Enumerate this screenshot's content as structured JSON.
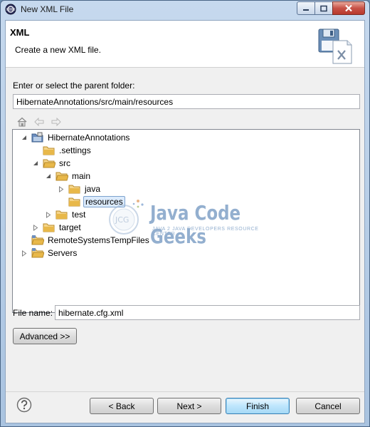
{
  "window": {
    "title": "New XML File"
  },
  "header": {
    "title": "XML",
    "description": "Create a new XML file."
  },
  "parent_folder": {
    "label": "Enter or select the parent folder:",
    "value": "HibernateAnnotations/src/main/resources"
  },
  "tree": {
    "items": [
      {
        "label": "HibernateAnnotations",
        "icon": "project-icon",
        "expanded": true
      },
      {
        "label": ".settings",
        "icon": "folder-icon"
      },
      {
        "label": "src",
        "icon": "folder-icon",
        "expanded": true
      },
      {
        "label": "main",
        "icon": "folder-icon",
        "expanded": true
      },
      {
        "label": "java",
        "icon": "folder-icon",
        "expanded": false
      },
      {
        "label": "resources",
        "icon": "folder-icon",
        "selected": true
      },
      {
        "label": "test",
        "icon": "folder-icon",
        "expanded": false
      },
      {
        "label": "target",
        "icon": "folder-icon",
        "expanded": false
      },
      {
        "label": "RemoteSystemsTempFiles",
        "icon": "project-folder-icon"
      },
      {
        "label": "Servers",
        "icon": "project-folder-icon",
        "expanded": false
      }
    ]
  },
  "watermark": {
    "name": "Java Code Geeks",
    "tagline": "JAVA 2 JAVA DEVELOPERS RESOURCE CENTER",
    "badge": "JCG"
  },
  "file_name": {
    "label": "File name:",
    "value": "hibernate.cfg.xml"
  },
  "buttons": {
    "advanced": "Advanced >>",
    "back": "< Back",
    "next": "Next >",
    "finish": "Finish",
    "cancel": "Cancel"
  },
  "colors": {
    "accent": "#3c7fb1",
    "selection": "#dcebfc",
    "folder": "#e8b84a"
  }
}
